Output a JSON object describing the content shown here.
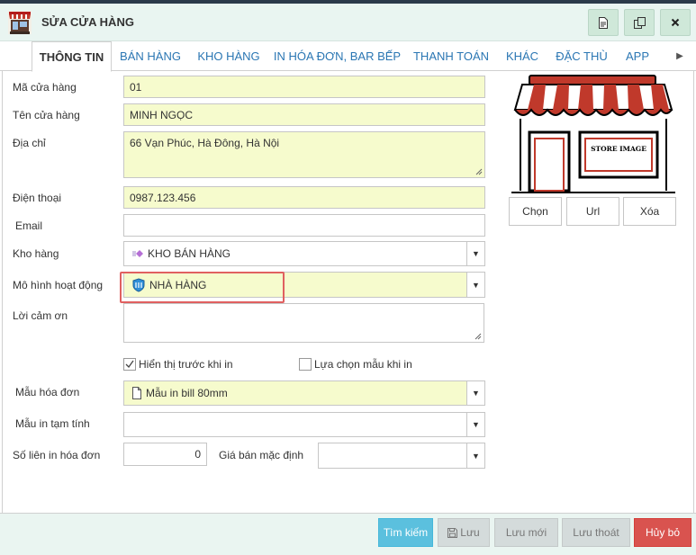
{
  "window": {
    "title": "SỬA CỬA HÀNG"
  },
  "tabs": [
    {
      "label": "THÔNG TIN",
      "active": true
    },
    {
      "label": "BÁN HÀNG"
    },
    {
      "label": "KHO HÀNG"
    },
    {
      "label": "IN HÓA ĐƠN, BAR BẾP"
    },
    {
      "label": "THANH TOÁN"
    },
    {
      "label": "KHÁC"
    },
    {
      "label": "ĐẶC THÙ"
    },
    {
      "label": "APP"
    }
  ],
  "form": {
    "store_code": {
      "label": "Mã cửa hàng",
      "value": "01"
    },
    "store_name": {
      "label": "Tên cửa hàng",
      "value": "MINH NGỌC"
    },
    "address": {
      "label": "Địa chỉ",
      "value": "66 Vạn Phúc, Hà Đông, Hà Nội"
    },
    "phone": {
      "label": "Điện thoại",
      "value": "0987.123.456"
    },
    "email": {
      "label": "Email",
      "value": ""
    },
    "warehouse": {
      "label": "Kho hàng",
      "value": "KHO BÁN HÀNG"
    },
    "business_model": {
      "label": "Mô hình hoạt động",
      "value": "NHÀ HÀNG"
    },
    "thanks_message": {
      "label": "Lời cảm ơn",
      "value": ""
    },
    "show_before_print": {
      "label": "Hiển thị trước khi in",
      "checked": true
    },
    "choose_template_when_print": {
      "label": "Lựa chọn mẫu khi in",
      "checked": false
    },
    "invoice_template": {
      "label": "Mẫu hóa đơn",
      "value": "Mẫu in bill 80mm"
    },
    "temp_print_template": {
      "label": "Mẫu in tạm tính",
      "value": ""
    },
    "invoice_copies": {
      "label": "Số liên in hóa đơn",
      "value": "0"
    },
    "default_price": {
      "label": "Giá bán mặc định",
      "value": ""
    }
  },
  "store_image": {
    "sign_text": "STORE IMAGE",
    "buttons": {
      "choose": "Chọn",
      "url": "Url",
      "delete": "Xóa"
    }
  },
  "footer": {
    "search": "Tìm kiếm",
    "save": "Lưu",
    "save_new": "Lưu mới",
    "save_exit": "Lưu thoát",
    "cancel": "Hủy bỏ"
  },
  "colors": {
    "accent": "#5bc0de",
    "danger": "#d9534f",
    "title_bar": "#e9f5f1",
    "input_highlight": "#f6fbcd",
    "tab_link": "#2a76b3"
  },
  "icons": {
    "title": "store-icon",
    "document": "document-icon",
    "copy": "copy-icon",
    "close": "close-icon",
    "warehouse": "warehouse-icon",
    "business_model": "restaurant-icon",
    "invoice_template": "page-icon",
    "save": "floppy-icon"
  }
}
